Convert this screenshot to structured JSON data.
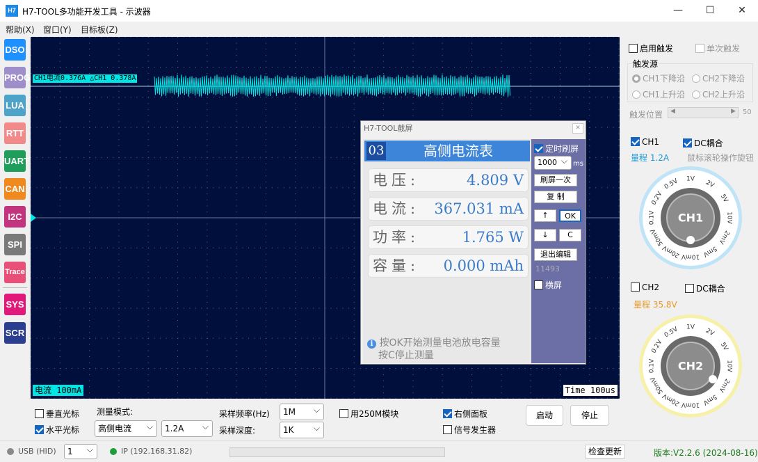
{
  "window": {
    "title": "H7-TOOL多功能开发工具 - 示波器",
    "icon_text": "H7"
  },
  "menu": [
    "帮助(X)",
    "窗口(Y)",
    "目标板(Z)"
  ],
  "modules": [
    {
      "label": "DSO",
      "color": "#1e90ff"
    },
    {
      "label": "PROG",
      "color": "#9e8ec9"
    },
    {
      "label": "LUA",
      "color": "#4fa3c9"
    },
    {
      "label": "RTT",
      "color": "#f28a8a"
    },
    {
      "label": "UART",
      "color": "#1e9e5a"
    },
    {
      "label": "CAN",
      "color": "#f08a1e"
    },
    {
      "label": "I2C",
      "color": "#c2347e"
    },
    {
      "label": "SPI",
      "color": "#7a7a7a"
    },
    {
      "label": "Trace",
      "color": "#e8507a"
    },
    {
      "label": "SYS",
      "color": "#e0197a"
    },
    {
      "label": "SCR",
      "color": "#2a3f8f"
    }
  ],
  "scope": {
    "ch1_label": "CH1电流0.376A  △CH1 0.378A",
    "range_label": "电流 100mA",
    "time_label": "Time 100us",
    "trace_color": "#00e5e5"
  },
  "screenshot_dialog": {
    "title": "H7-TOOL截屏",
    "page_num": "03",
    "page_title": "高侧电流表",
    "rows": [
      {
        "name": "电压:",
        "value": "4.809 V"
      },
      {
        "name": "电流:",
        "value": "367.031 mA"
      },
      {
        "name": "功率:",
        "value": "1.765 W"
      },
      {
        "name": "容量:",
        "value": "0.000 mAh"
      }
    ],
    "hint_line1": "按OK开始测量电池放电容量",
    "hint_line2": "按C停止测量",
    "timer_refresh": "定时刷屏",
    "interval": "1000",
    "interval_unit": "ms",
    "refresh_once": "刷屏一次",
    "copy": "复 制",
    "up": "↑",
    "ok": "OK",
    "down": "↓",
    "c": "C",
    "exit_edit": "退出编辑",
    "counter": "11493",
    "landscape": "横屏"
  },
  "trigger": {
    "enable": "启用触发",
    "single": "单次触发",
    "source_title": "触发源",
    "sources": [
      "CH1下降沿",
      "CH2下降沿",
      "CH1上升沿",
      "CH2上升沿"
    ],
    "position_label": "触发位置",
    "position_value": "50"
  },
  "ch1": {
    "label": "CH1",
    "coupling": "DC耦合",
    "range": "量程 1.2A",
    "hint": "鼠标滚轮操作旋钮",
    "knob_label": "CH1",
    "ticks": [
      "0.1V",
      "0.2V",
      "0.5V",
      "1V",
      "2V",
      "5V",
      "10V",
      "2mV",
      "5mV",
      "10mV",
      "20mV",
      "50mV"
    ],
    "ring_color": "#bfe3f7"
  },
  "ch2": {
    "label": "CH2",
    "coupling": "DC耦合",
    "range": "量程 35.8V",
    "knob_label": "CH2",
    "ticks": [
      "0.1V",
      "0.2V",
      "0.5V",
      "1V",
      "2V",
      "5V",
      "10V",
      "2mV",
      "5mV",
      "10mV",
      "20mV",
      "50mV"
    ],
    "ring_color": "#f7f0a8"
  },
  "bottom": {
    "vcursor": "垂直光标",
    "hcursor": "水平光标",
    "mode_label": "测量模式:",
    "mode_value": "高侧电流",
    "range_value": "1.2A",
    "rate_label": "采样频率(Hz)",
    "rate_value": "1M",
    "depth_label": "采样深度:",
    "depth_value": "1K",
    "m250": "用250M模块",
    "right_panel": "右侧面板",
    "siggen": "信号发生器",
    "start": "启动",
    "stop": "停止"
  },
  "status": {
    "usb": "USB (HID)",
    "port": "1",
    "ip": "IP (192.168.31.82)",
    "check_update": "检查更新",
    "version": "版本:V2.2.6 (2024-08-16)"
  }
}
